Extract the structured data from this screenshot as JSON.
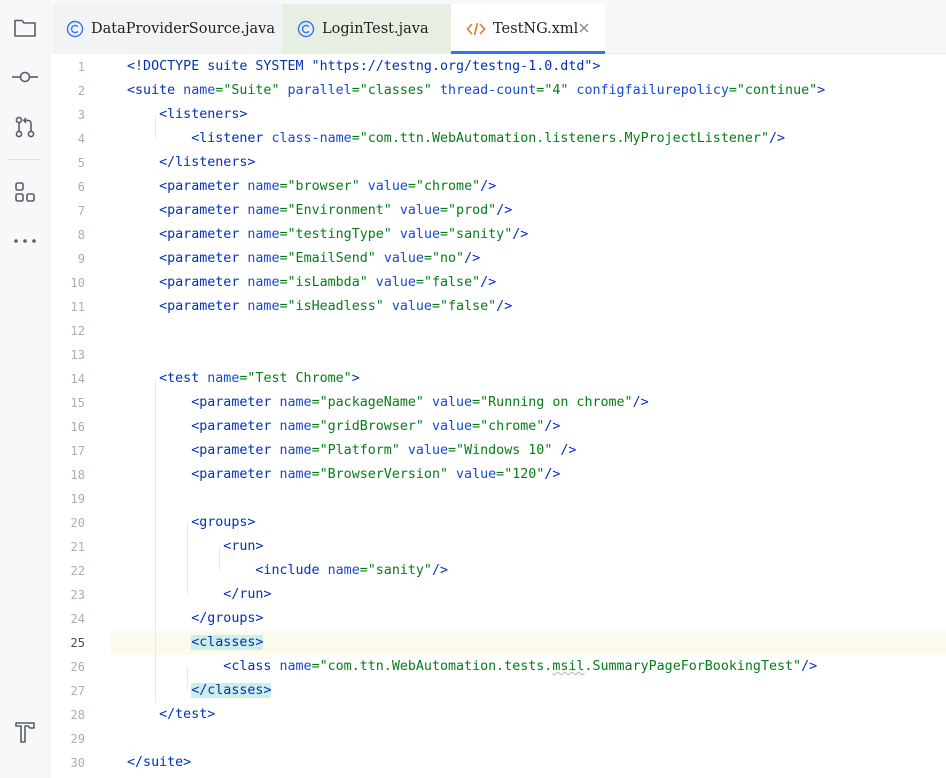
{
  "tabs": [
    {
      "label": "DataProviderSource.java",
      "icon": "java-class-icon",
      "active": false
    },
    {
      "label": "LoginTest.java",
      "icon": "java-class-icon",
      "active": false
    },
    {
      "label": "TestNG.xml",
      "icon": "xml-file-icon",
      "active": true
    }
  ],
  "toolbar": [
    "project-icon",
    "commit-icon",
    "pull-requests-icon",
    "structure-icon",
    "more-icon",
    "build-icon"
  ],
  "colors": {
    "accent": "#3574f0",
    "tag": "#0033b3",
    "attr_name": "#174ad4",
    "attr_value": "#067d17",
    "match_highlight": "#cdeee8",
    "caret_line": "#fcfaed"
  },
  "editor": {
    "current_line": 25,
    "lines": [
      {
        "num": "1",
        "text": "<!DOCTYPE suite SYSTEM \"https://testng.org/testng-1.0.dtd\">"
      },
      {
        "num": "2",
        "text": "<suite name=\"Suite\" parallel=\"classes\" thread-count=\"4\" configfailurepolicy=\"continue\">"
      },
      {
        "num": "3",
        "text": "    <listeners>"
      },
      {
        "num": "4",
        "text": "        <listener class-name=\"com.ttn.WebAutomation.listeners.MyProjectListener\"/>"
      },
      {
        "num": "5",
        "text": "    </listeners>"
      },
      {
        "num": "6",
        "text": "    <parameter name=\"browser\" value=\"chrome\"/>"
      },
      {
        "num": "7",
        "text": "    <parameter name=\"Environment\" value=\"prod\"/>"
      },
      {
        "num": "8",
        "text": "    <parameter name=\"testingType\" value=\"sanity\"/>"
      },
      {
        "num": "9",
        "text": "    <parameter name=\"EmailSend\" value=\"no\"/>"
      },
      {
        "num": "10",
        "text": "    <parameter name=\"isLambda\" value=\"false\"/>"
      },
      {
        "num": "11",
        "text": "    <parameter name=\"isHeadless\" value=\"false\"/>"
      },
      {
        "num": "12",
        "text": ""
      },
      {
        "num": "13",
        "text": ""
      },
      {
        "num": "14",
        "text": "    <test name=\"Test Chrome\">"
      },
      {
        "num": "15",
        "text": "        <parameter name=\"packageName\" value=\"Running on chrome\"/>"
      },
      {
        "num": "16",
        "text": "        <parameter name=\"gridBrowser\" value=\"chrome\"/>"
      },
      {
        "num": "17",
        "text": "        <parameter name=\"Platform\" value=\"Windows 10\" />"
      },
      {
        "num": "18",
        "text": "        <parameter name=\"BrowserVersion\" value=\"120\"/>"
      },
      {
        "num": "19",
        "text": ""
      },
      {
        "num": "20",
        "text": "        <groups>"
      },
      {
        "num": "21",
        "text": "            <run>"
      },
      {
        "num": "22",
        "text": "                <include name=\"sanity\"/>"
      },
      {
        "num": "23",
        "text": "            </run>"
      },
      {
        "num": "24",
        "text": "        </groups>"
      },
      {
        "num": "25",
        "text": "        <classes>"
      },
      {
        "num": "26",
        "text": "            <class name=\"com.ttn.WebAutomation.tests.msil.SummaryPageForBookingTest\"/>"
      },
      {
        "num": "27",
        "text": "        </classes>"
      },
      {
        "num": "28",
        "text": "    </test>"
      },
      {
        "num": "29",
        "text": ""
      },
      {
        "num": "30",
        "text": "</suite>"
      }
    ]
  }
}
